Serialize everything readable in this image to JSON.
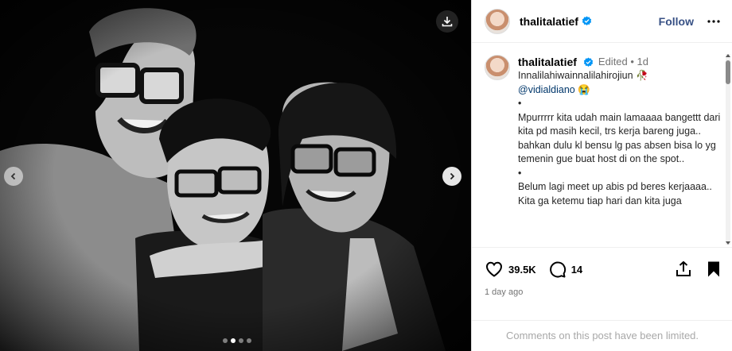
{
  "post": {
    "username": "thalitalatief",
    "follow_label": "Follow",
    "caption_meta": "Edited • 1d",
    "caption_line1": "Innalilahiwainnalilahirojiun 🥀",
    "mention": "@vidialdiano",
    "mention_emoji": "😭",
    "bullet": "•",
    "paragraph1": "Mpurrrrr kita udah main lamaaaa bangettt dari kita pd masih kecil, trs kerja bareng juga.. bahkan dulu kl bensu lg pas absen bisa lo yg temenin gue buat host di on the spot..",
    "paragraph2": "Belum lagi meet up abis pd beres kerjaaaa..",
    "paragraph3": "Kita ga ketemu tiap hari dan kita juga",
    "likes": "39.5K",
    "comments": "14",
    "time_ago": "1 day ago",
    "comments_limited": "Comments on this post have been limited."
  },
  "carousel": {
    "slide_count": 4,
    "active_index": 1
  },
  "colors": {
    "link": "#00376b",
    "follow": "#385185",
    "verified": "#0095f6"
  },
  "icons": [
    "download-icon",
    "chevron-left-icon",
    "chevron-right-icon",
    "verified-icon",
    "more-icon",
    "heart-icon",
    "comment-icon",
    "share-icon",
    "bookmark-icon"
  ]
}
